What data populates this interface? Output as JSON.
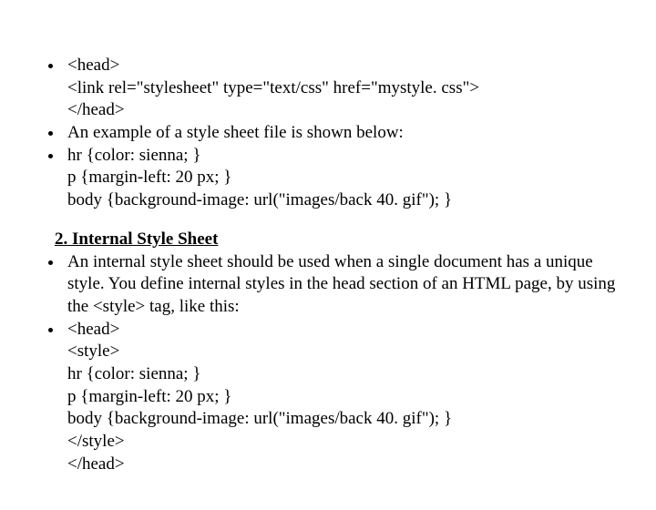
{
  "section1": {
    "items": [
      {
        "lines": [
          "<head>",
          "<link rel=\"stylesheet\" type=\"text/css\" href=\"mystyle. css\">",
          "</head>"
        ]
      },
      {
        "lines": [
          "An example of a style sheet file is shown below:"
        ]
      },
      {
        "lines": [
          "hr {color: sienna; }",
          "p {margin-left: 20 px; }",
          "body {background-image: url(\"images/back 40. gif\"); }"
        ]
      }
    ]
  },
  "section2": {
    "heading": "2. Internal Style Sheet",
    "items": [
      {
        "lines": [
          "An internal style sheet should be used when a single document has a unique style. You define internal styles in the head section of an HTML page, by using the <style> tag, like this:"
        ]
      },
      {
        "lines": [
          "<head>",
          "<style>",
          "hr {color: sienna; }",
          "p {margin-left: 20 px; }",
          "body {background-image: url(\"images/back 40. gif\"); }",
          "</style>",
          "</head>"
        ]
      }
    ]
  }
}
